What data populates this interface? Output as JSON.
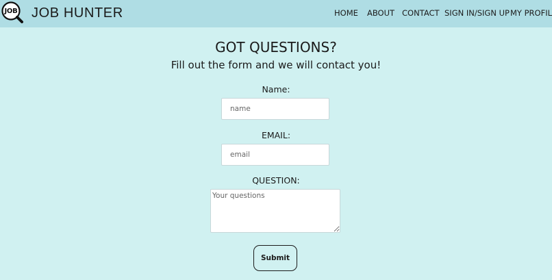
{
  "header": {
    "logo_text": "JOB",
    "brand": "JOB HUNTER",
    "nav": {
      "home": "HOME",
      "about": "ABOUT",
      "contact": "CONTACT",
      "sign": "SIGN IN/SIGN UP",
      "profile": "MY PROFILE"
    }
  },
  "main": {
    "title": "GOT QUESTIONS?",
    "subtitle": "Fill out the form and we will contact you!",
    "form": {
      "name_label": "Name:",
      "name_placeholder": "name",
      "email_label": "EMAIL:",
      "email_placeholder": "email",
      "question_label": "QUESTION:",
      "question_placeholder": "Your questions",
      "submit_label": "Submit"
    }
  },
  "colors": {
    "page_background": "#d0f1f1",
    "header_background": "#afdde4",
    "text": "#1a1a1a"
  },
  "icons": {
    "logo": "magnifier-icon"
  }
}
